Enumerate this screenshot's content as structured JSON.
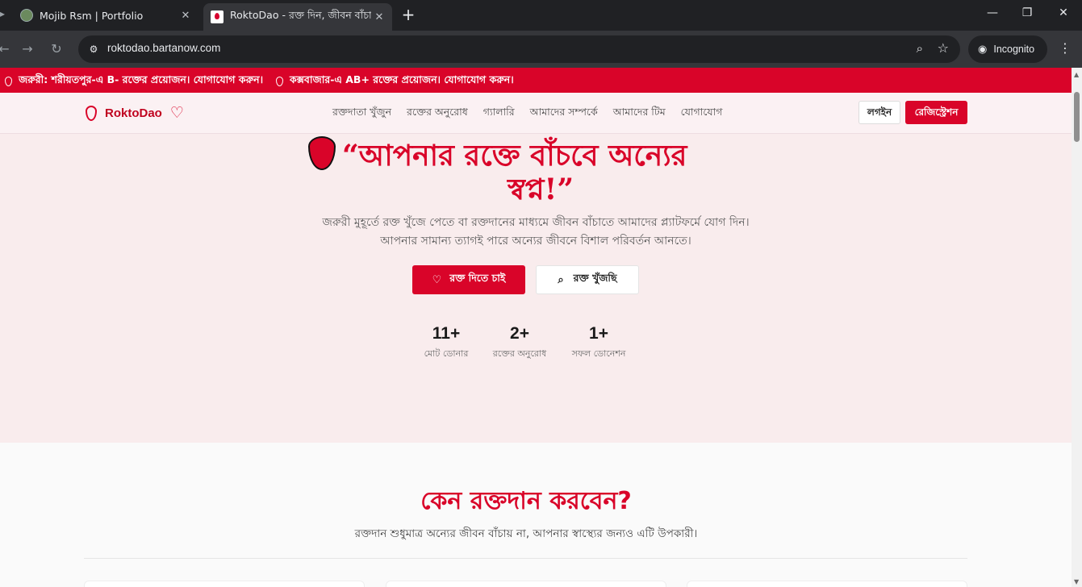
{
  "browser": {
    "tabs": [
      {
        "title": "Mojib Rsm | Portfolio",
        "active": false
      },
      {
        "title": "RoktoDao - রক্ত দিন, জীবন বাঁচা",
        "active": true
      }
    ],
    "url": "roktodao.bartanow.com",
    "incognito_label": "Incognito"
  },
  "ticker": {
    "items": [
      "জরুরী: শরীয়তপুর-এ B- রক্তের প্রয়োজন। যোগাযোগ করুন।",
      "কক্সবাজার-এ AB+ রক্তের প্রয়োজন। যোগাযোগ করুন।"
    ]
  },
  "nav": {
    "brand": "RoktoDao",
    "links": [
      "রক্তদাতা খুঁজুন",
      "রক্তের অনুরোধ",
      "গ্যালারি",
      "আমাদের সম্পর্কে",
      "আমাদের টিম",
      "যোগাযোগ"
    ],
    "login": "লগইন",
    "register": "রেজিস্ট্রেশন"
  },
  "hero": {
    "title_line1": "“আপনার রক্তে বাঁচবে অন্যের",
    "title_line2": "স্বপ্ন!”",
    "subtitle": "জরুরী মুহূর্তে রক্ত খুঁজে পেতে বা রক্তদানের মাধ্যমে জীবন বাঁচাতে আমাদের প্ল্যাটফর্মে যোগ দিন। আপনার সামান্য ত্যাগই পারে অন্যের জীবনে বিশাল পরিবর্তন আনতে।",
    "btn_give": "রক্ত দিতে চাই",
    "btn_seek": "রক্ত খুঁজছি",
    "stats": [
      {
        "value": "11+",
        "label": "মোট ডোনার"
      },
      {
        "value": "2+",
        "label": "রক্তের অনুরোধ"
      },
      {
        "value": "1+",
        "label": "সফল ডোনেশন"
      }
    ]
  },
  "why": {
    "title": "কেন রক্তদান করবেন?",
    "subtitle": "রক্তদান শুধুমাত্র অন্যের জীবন বাঁচায় না, আপনার স্বাস্থ্যের জন্যও এটি উপকারী।"
  },
  "colors": {
    "brand": "#d90429",
    "hero_bg": "#f9eced"
  }
}
